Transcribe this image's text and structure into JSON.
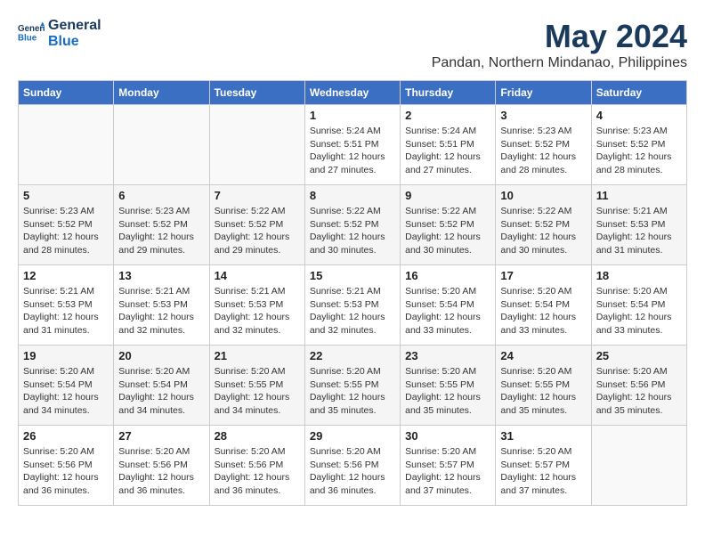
{
  "header": {
    "logo_line1": "General",
    "logo_line2": "Blue",
    "month_year": "May 2024",
    "location": "Pandan, Northern Mindanao, Philippines"
  },
  "days_of_week": [
    "Sunday",
    "Monday",
    "Tuesday",
    "Wednesday",
    "Thursday",
    "Friday",
    "Saturday"
  ],
  "weeks": [
    [
      {
        "day": "",
        "info": ""
      },
      {
        "day": "",
        "info": ""
      },
      {
        "day": "",
        "info": ""
      },
      {
        "day": "1",
        "info": "Sunrise: 5:24 AM\nSunset: 5:51 PM\nDaylight: 12 hours\nand 27 minutes."
      },
      {
        "day": "2",
        "info": "Sunrise: 5:24 AM\nSunset: 5:51 PM\nDaylight: 12 hours\nand 27 minutes."
      },
      {
        "day": "3",
        "info": "Sunrise: 5:23 AM\nSunset: 5:52 PM\nDaylight: 12 hours\nand 28 minutes."
      },
      {
        "day": "4",
        "info": "Sunrise: 5:23 AM\nSunset: 5:52 PM\nDaylight: 12 hours\nand 28 minutes."
      }
    ],
    [
      {
        "day": "5",
        "info": "Sunrise: 5:23 AM\nSunset: 5:52 PM\nDaylight: 12 hours\nand 28 minutes."
      },
      {
        "day": "6",
        "info": "Sunrise: 5:23 AM\nSunset: 5:52 PM\nDaylight: 12 hours\nand 29 minutes."
      },
      {
        "day": "7",
        "info": "Sunrise: 5:22 AM\nSunset: 5:52 PM\nDaylight: 12 hours\nand 29 minutes."
      },
      {
        "day": "8",
        "info": "Sunrise: 5:22 AM\nSunset: 5:52 PM\nDaylight: 12 hours\nand 30 minutes."
      },
      {
        "day": "9",
        "info": "Sunrise: 5:22 AM\nSunset: 5:52 PM\nDaylight: 12 hours\nand 30 minutes."
      },
      {
        "day": "10",
        "info": "Sunrise: 5:22 AM\nSunset: 5:52 PM\nDaylight: 12 hours\nand 30 minutes."
      },
      {
        "day": "11",
        "info": "Sunrise: 5:21 AM\nSunset: 5:53 PM\nDaylight: 12 hours\nand 31 minutes."
      }
    ],
    [
      {
        "day": "12",
        "info": "Sunrise: 5:21 AM\nSunset: 5:53 PM\nDaylight: 12 hours\nand 31 minutes."
      },
      {
        "day": "13",
        "info": "Sunrise: 5:21 AM\nSunset: 5:53 PM\nDaylight: 12 hours\nand 32 minutes."
      },
      {
        "day": "14",
        "info": "Sunrise: 5:21 AM\nSunset: 5:53 PM\nDaylight: 12 hours\nand 32 minutes."
      },
      {
        "day": "15",
        "info": "Sunrise: 5:21 AM\nSunset: 5:53 PM\nDaylight: 12 hours\nand 32 minutes."
      },
      {
        "day": "16",
        "info": "Sunrise: 5:20 AM\nSunset: 5:54 PM\nDaylight: 12 hours\nand 33 minutes."
      },
      {
        "day": "17",
        "info": "Sunrise: 5:20 AM\nSunset: 5:54 PM\nDaylight: 12 hours\nand 33 minutes."
      },
      {
        "day": "18",
        "info": "Sunrise: 5:20 AM\nSunset: 5:54 PM\nDaylight: 12 hours\nand 33 minutes."
      }
    ],
    [
      {
        "day": "19",
        "info": "Sunrise: 5:20 AM\nSunset: 5:54 PM\nDaylight: 12 hours\nand 34 minutes."
      },
      {
        "day": "20",
        "info": "Sunrise: 5:20 AM\nSunset: 5:54 PM\nDaylight: 12 hours\nand 34 minutes."
      },
      {
        "day": "21",
        "info": "Sunrise: 5:20 AM\nSunset: 5:55 PM\nDaylight: 12 hours\nand 34 minutes."
      },
      {
        "day": "22",
        "info": "Sunrise: 5:20 AM\nSunset: 5:55 PM\nDaylight: 12 hours\nand 35 minutes."
      },
      {
        "day": "23",
        "info": "Sunrise: 5:20 AM\nSunset: 5:55 PM\nDaylight: 12 hours\nand 35 minutes."
      },
      {
        "day": "24",
        "info": "Sunrise: 5:20 AM\nSunset: 5:55 PM\nDaylight: 12 hours\nand 35 minutes."
      },
      {
        "day": "25",
        "info": "Sunrise: 5:20 AM\nSunset: 5:56 PM\nDaylight: 12 hours\nand 35 minutes."
      }
    ],
    [
      {
        "day": "26",
        "info": "Sunrise: 5:20 AM\nSunset: 5:56 PM\nDaylight: 12 hours\nand 36 minutes."
      },
      {
        "day": "27",
        "info": "Sunrise: 5:20 AM\nSunset: 5:56 PM\nDaylight: 12 hours\nand 36 minutes."
      },
      {
        "day": "28",
        "info": "Sunrise: 5:20 AM\nSunset: 5:56 PM\nDaylight: 12 hours\nand 36 minutes."
      },
      {
        "day": "29",
        "info": "Sunrise: 5:20 AM\nSunset: 5:56 PM\nDaylight: 12 hours\nand 36 minutes."
      },
      {
        "day": "30",
        "info": "Sunrise: 5:20 AM\nSunset: 5:57 PM\nDaylight: 12 hours\nand 37 minutes."
      },
      {
        "day": "31",
        "info": "Sunrise: 5:20 AM\nSunset: 5:57 PM\nDaylight: 12 hours\nand 37 minutes."
      },
      {
        "day": "",
        "info": ""
      }
    ]
  ]
}
